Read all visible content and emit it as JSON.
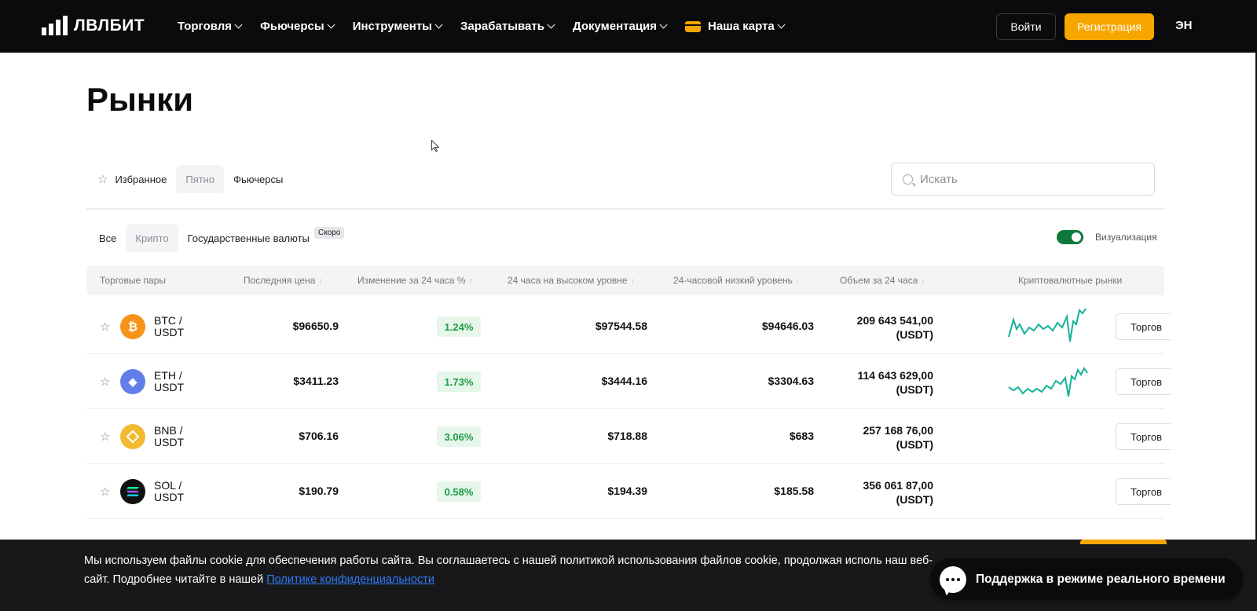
{
  "brand": {
    "logo_text": "ЛВЛБИТ"
  },
  "nav": {
    "items": [
      {
        "label": "Торговля"
      },
      {
        "label": "Фьючерсы"
      },
      {
        "label": "Инструменты"
      },
      {
        "label": "Зарабатывать"
      },
      {
        "label": "Документация"
      },
      {
        "label": "Наша карта"
      }
    ],
    "login_label": "Войти",
    "register_label": "Регистрация",
    "language": "ЭН"
  },
  "page": {
    "title": "Рынки"
  },
  "market_tabs": {
    "favorites": "Избранное",
    "spot": "Пятно",
    "futures": "Фьючерсы",
    "active": "Пятно"
  },
  "search": {
    "placeholder": "Искать"
  },
  "category_tabs": {
    "all": "Все",
    "crypto": "Крипто",
    "fiat": "Государственные валюты",
    "soon_badge": "Скоро",
    "active": "Крипто"
  },
  "visualization": {
    "label": "Визуализация",
    "enabled": true
  },
  "table": {
    "headers": {
      "pair": "Торговые пары",
      "last_price": "Последняя цена",
      "change": "Изменение за 24 часа %",
      "high": "24 часа на высоком уровне",
      "low": "24-часовой низкий уровень",
      "volume": "Объем за 24 часа",
      "markets": "Криптовалютные рынки"
    },
    "rows": [
      {
        "base": "BTC /",
        "quote": "USDT",
        "icon": "bitcoin-icon",
        "color": "#f7931a",
        "last": "$96650.9",
        "change": "1.24%",
        "high": "$97544.58",
        "low": "$94646.03",
        "volume": "209 643 541,00",
        "volume_unit": "(USDT)",
        "trade_label": "Торгов",
        "sparkline": true
      },
      {
        "base": "ETH /",
        "quote": "USDT",
        "icon": "ethereum-icon",
        "color": "#627eea",
        "last": "$3411.23",
        "change": "1.73%",
        "high": "$3444.16",
        "low": "$3304.63",
        "volume": "114 643 629,00",
        "volume_unit": "(USDT)",
        "trade_label": "Торгов",
        "sparkline": true
      },
      {
        "base": "BNB /",
        "quote": "USDT",
        "icon": "bnb-icon",
        "color": "#f3ba2f",
        "last": "$706.16",
        "change": "3.06%",
        "high": "$718.88",
        "low": "$683",
        "volume": "257 168 76,00",
        "volume_unit": "(USDT)",
        "trade_label": "Торгов",
        "sparkline": false
      },
      {
        "base": "SOL /",
        "quote": "USDT",
        "icon": "solana-icon",
        "color": "#111111",
        "last": "$190.79",
        "change": "0.58%",
        "high": "$194.39",
        "low": "$185.58",
        "volume": "356 061 87,00",
        "volume_unit": "(USDT)",
        "trade_label": "Торгов",
        "sparkline": false
      }
    ]
  },
  "cookie": {
    "text": "Мы используем файлы cookie для обеспечения работы сайта. Вы соглашаетесь с нашей политикой использования файлов cookie, продолжая исполь наш веб-сайт. Подробнее читайте в нашей",
    "link_text": "Политике конфиденциальности"
  },
  "support": {
    "label": "Поддержка в режиме реального времени"
  },
  "colors": {
    "accent": "#f7a600",
    "positive": "#1d9d45",
    "toggle": "#0b7a3b",
    "sparkline": "#14b39a"
  }
}
